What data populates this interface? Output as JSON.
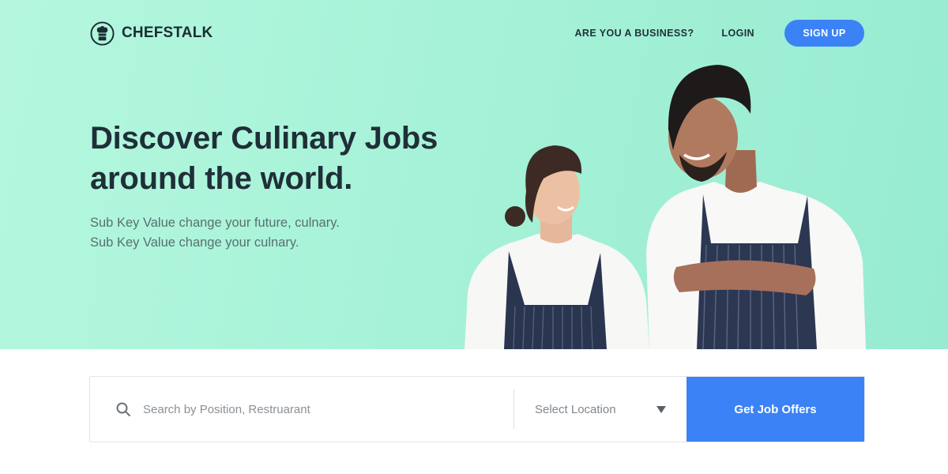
{
  "header": {
    "brand": "CHEFSTALK",
    "logo_icon": "chef-hat-logo-icon",
    "nav": {
      "business": "ARE YOU A BUSINESS?",
      "login": "LOGIN",
      "signup": "SIGN UP"
    }
  },
  "hero": {
    "headline_line1": "Discover Culinary Jobs",
    "headline_line2": "around the world.",
    "sub_line1": "Sub Key Value change your future, culnary.",
    "sub_line2": "Sub Key Value change your culnary."
  },
  "search": {
    "position_placeholder": "Search by Position, Restruarant",
    "search_icon": "search-icon",
    "location_label": "Select Location",
    "location_icon": "caret-down-icon",
    "submit": "Get Job Offers"
  },
  "colors": {
    "hero_bg": "#a6f2d8",
    "accent": "#3b82f6",
    "text_dark": "#1f2f38",
    "text_muted": "#58716f"
  }
}
